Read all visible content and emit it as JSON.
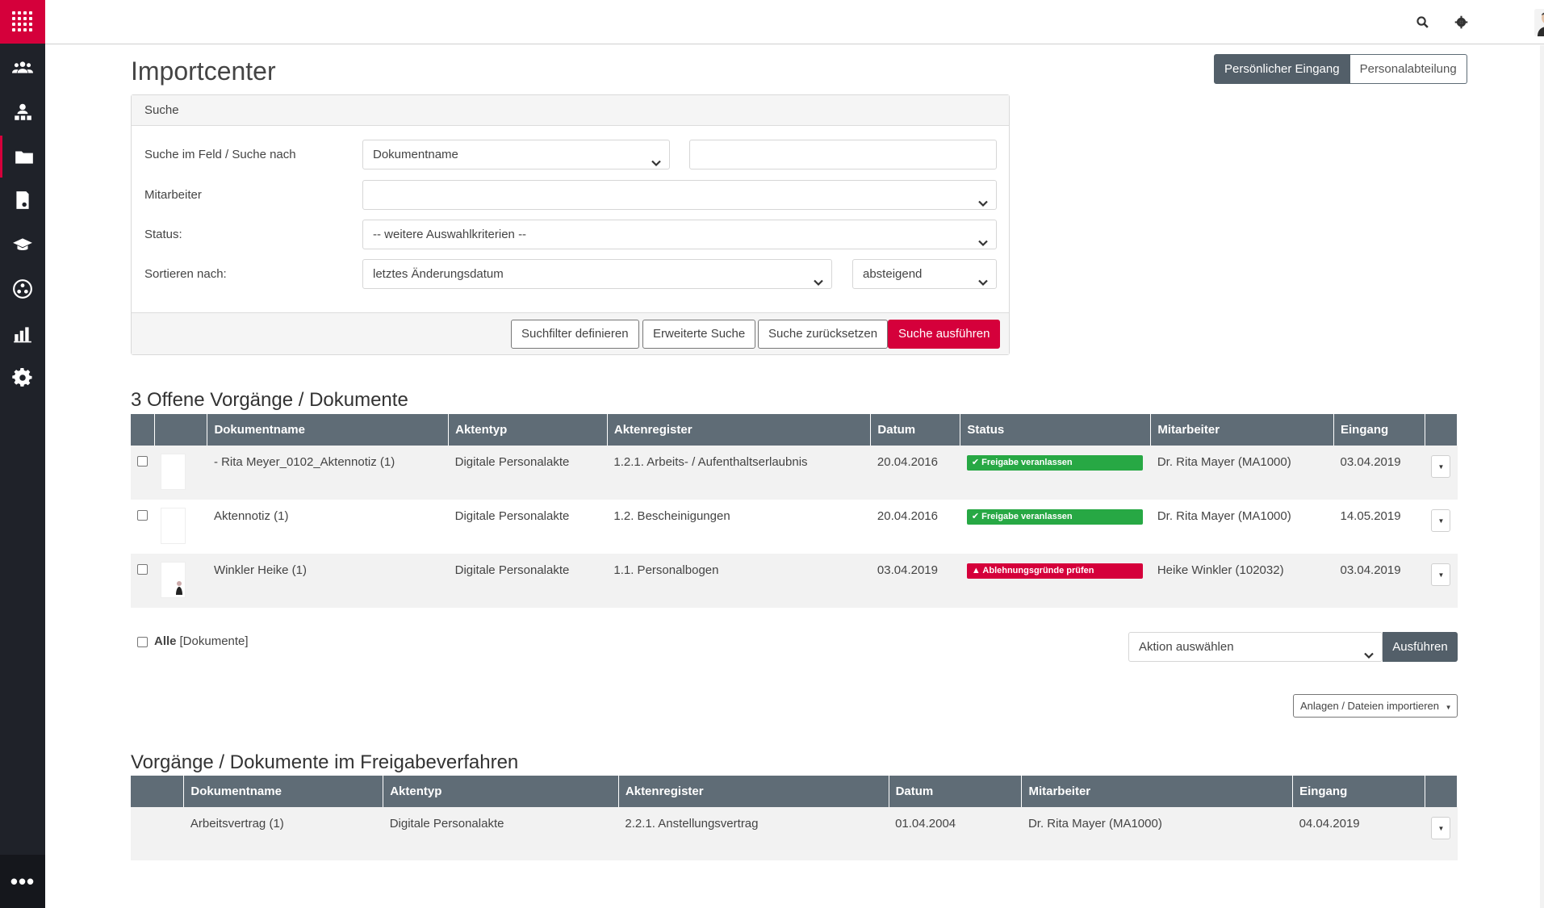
{
  "sidebar": {
    "items": [
      {
        "icon": "team-icon",
        "active": false
      },
      {
        "icon": "org-icon",
        "active": false
      },
      {
        "icon": "folder-icon",
        "active": true
      },
      {
        "icon": "document-icon",
        "active": false
      },
      {
        "icon": "graduation-cap-icon",
        "active": false
      },
      {
        "icon": "network-icon",
        "active": false
      },
      {
        "icon": "chart-icon",
        "active": false
      },
      {
        "icon": "gear-icon",
        "active": false
      }
    ],
    "more_label": "•••"
  },
  "topbar": {
    "icons": [
      "search-icon",
      "gear-icon",
      "avatar"
    ]
  },
  "page": {
    "title": "Importcenter",
    "toggle": {
      "personal": "Persönlicher Eingang",
      "department": "Personalabteilung"
    }
  },
  "search": {
    "header": "Suche",
    "field_label": "Suche im Feld / Suche nach",
    "field_select": "Dokumentname",
    "field_value": "",
    "employee_label": "Mitarbeiter",
    "employee_value": "",
    "status_label": "Status:",
    "status_value": "-- weitere Auswahlkriterien --",
    "sort_label": "Sortieren nach:",
    "sort_value": "letztes Änderungsdatum",
    "sort_dir": "absteigend",
    "buttons": {
      "define_filter": "Suchfilter definieren",
      "advanced": "Erweiterte Suche",
      "reset": "Suche zurücksetzen",
      "execute": "Suche ausführen"
    }
  },
  "open_docs": {
    "title": "3 Offene Vorgänge / Dokumente",
    "columns": [
      "Dokumentname",
      "Aktentyp",
      "Aktenregister",
      "Datum",
      "Status",
      "Mitarbeiter",
      "Eingang"
    ],
    "rows": [
      {
        "name": "- Rita Meyer_0102_Aktennotiz (1)",
        "type": "Digitale Personalakte",
        "register": "1.2.1. Arbeits- / Aufenthaltserlaubnis",
        "date": "20.04.2016",
        "status": "Freigabe veranlassen",
        "status_color": "#27a844",
        "employee": "Dr. Rita Mayer (MA1000)",
        "inbox": "03.04.2019"
      },
      {
        "name": "Aktennotiz (1)",
        "type": "Digitale Personalakte",
        "register": "1.2. Bescheinigungen",
        "date": "20.04.2016",
        "status": "Freigabe veranlassen",
        "status_color": "#27a844",
        "employee": "Dr. Rita Mayer (MA1000)",
        "inbox": "14.05.2019"
      },
      {
        "name": "Winkler Heike (1)",
        "type": "Digitale Personalakte",
        "register": "1.1. Personalbogen",
        "date": "03.04.2019",
        "status": "Ablehnungsgründe prüfen",
        "status_color": "#d5003b",
        "employee": "Heike Winkler (102032)",
        "inbox": "03.04.2019"
      }
    ],
    "all_label": "Alle",
    "all_suffix": "[Dokumente]",
    "action_select": "Aktion auswählen",
    "action_button": "Ausführen",
    "import_button": "Anlagen / Dateien importieren"
  },
  "approval_docs": {
    "title": "Vorgänge / Dokumente im Freigabeverfahren",
    "columns": [
      "Dokumentname",
      "Aktentyp",
      "Aktenregister",
      "Datum",
      "Mitarbeiter",
      "Eingang"
    ],
    "rows": [
      {
        "name": "Arbeitsvertrag (1)",
        "type": "Digitale Personalakte",
        "register": "2.2.1. Anstellungsvertrag",
        "date": "01.04.2004",
        "employee": "Dr. Rita Mayer (MA1000)",
        "inbox": "04.04.2019"
      }
    ]
  }
}
